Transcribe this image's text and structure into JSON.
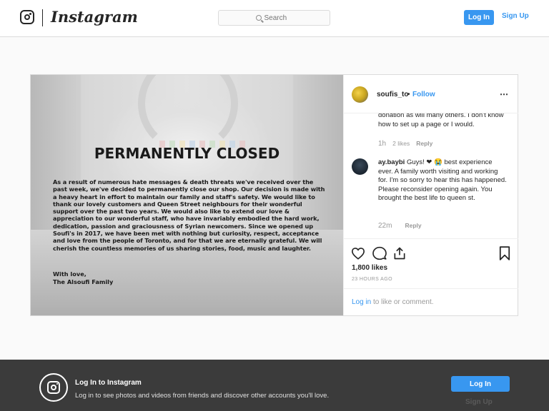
{
  "header": {
    "brand": "Instagram",
    "search_placeholder": "Search",
    "login_label": "Log In",
    "signup_label": "Sign Up"
  },
  "post": {
    "image": {
      "title": "PERMANENTLY CLOSED",
      "body": "As a result of numerous hate messages & death threats we've received over the past week, we've decided to permanently close our shop. Our decision is made with a heavy heart in effort to maintain our family and staff's safety. We would like to thank our lovely customers and Queen Street neighbours for their wonderful support over the past two years. We would also like to extend our love & appreciation to our wonderful staff, who have invariably embodied the hard work, dedication, passion and graciousness of Syrian newcomers. Since we opened up Soufi's in 2017, we have been met with nothing but curiosity, respect, acceptance and love from the people of Toronto, and for that we are eternally grateful. We will cherish the countless memories of us sharing stories, food, music and laughter.",
      "sign_line1": "With love,",
      "sign_line2": "The Alsoufi Family"
    },
    "owner": {
      "username": "soufis_to",
      "separator": "•",
      "follow_label": "Follow",
      "more_icon": "⋯"
    },
    "comments": [
      {
        "text": "donation as will many others. I don't know how to set up a page or I would.",
        "time": "1h",
        "likes": "2 likes",
        "reply": "Reply"
      },
      {
        "username": "ay.baybi",
        "text": "Guys! ❤ 😭 best experience ever. A family worth visiting and working for. I'm so sorry to hear this has happened. Please reconsider opening again. You brought the best life to queen st.",
        "time": "22m",
        "reply": "Reply"
      }
    ],
    "likes_count": "1,800 likes",
    "timestamp": "23 HOURS AGO",
    "add_comment_login": "Log in",
    "add_comment_rest": " to like or comment."
  },
  "banner": {
    "title": "Log In to Instagram",
    "subtitle": "Log in to see photos and videos from friends and discover other accounts you'll love.",
    "login_label": "Log In",
    "signup_label": "Sign Up"
  },
  "colors": {
    "accent": "#3897f0",
    "banner_bg": "#3b3b3b"
  }
}
